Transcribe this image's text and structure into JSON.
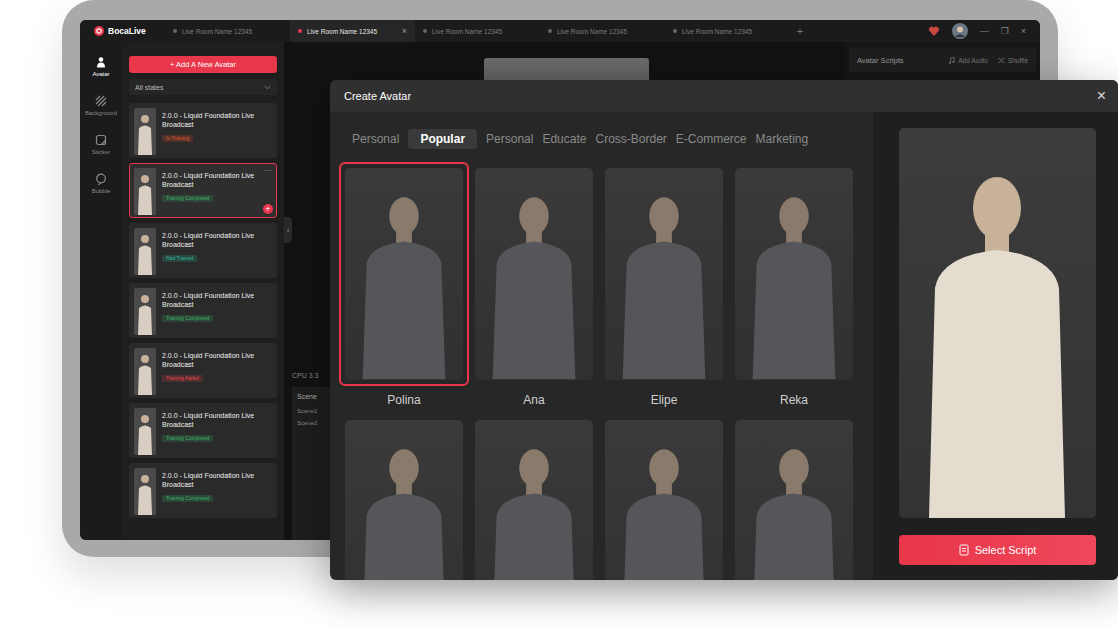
{
  "app": {
    "name": "BocaLive"
  },
  "tabs": [
    {
      "label": "Live Room Name 12345",
      "selected": false
    },
    {
      "label": "Live Room Name 12345",
      "selected": true
    },
    {
      "label": "Live Room Name 12345",
      "selected": false
    },
    {
      "label": "Live Room Name 12345",
      "selected": false
    },
    {
      "label": "Live Room Name 12345",
      "selected": false
    }
  ],
  "tab_close": "×",
  "new_tab": "+",
  "window_controls": [
    "—",
    "❐",
    "×"
  ],
  "rail": [
    {
      "label": "Avatar",
      "selected": true
    },
    {
      "label": "Background",
      "selected": false
    },
    {
      "label": "Sticker",
      "selected": false
    },
    {
      "label": "Bubble",
      "selected": false
    }
  ],
  "avatar_panel": {
    "add_button": "+ Add A New Avatar",
    "filter": "All states",
    "more": "···",
    "add": "+",
    "collapse": "‹",
    "items": [
      {
        "title": "2.0.0 - Liquid Foundation Live Broadcast",
        "status": "In Training",
        "color": "#e0552b",
        "selected": false
      },
      {
        "title": "2.0.0 - Liquid Foundation Live Broadcast",
        "status": "Training Completed",
        "color": "#3bb36a",
        "selected": true
      },
      {
        "title": "2.0.0 - Liquid Foundation Live Broadcast",
        "status": "Had Trained",
        "color": "#2fb59a",
        "selected": false
      },
      {
        "title": "2.0.0 - Liquid Foundation Live Broadcast",
        "status": "Training Completed",
        "color": "#3bb36a",
        "selected": false
      },
      {
        "title": "2.0.0 - Liquid Foundation Live Broadcast",
        "status": "Training Failed",
        "color": "#e5484d",
        "selected": false
      },
      {
        "title": "2.0.0 - Liquid Foundation Live Broadcast",
        "status": "Training Completed",
        "color": "#3bb36a",
        "selected": false
      },
      {
        "title": "2.0.0 - Liquid Foundation Live Broadcast",
        "status": "Training Completed",
        "color": "#3bb36a",
        "selected": false
      }
    ]
  },
  "stats": {
    "cpu": "CPU 3.3"
  },
  "scenes": {
    "title": "Scene",
    "items": [
      "Scene1",
      "Scene2"
    ]
  },
  "scripts_panel": {
    "title": "Avatar Scripts",
    "actions": [
      "Add Audio",
      "Shuffle"
    ]
  },
  "modal": {
    "title": "Create Avatar",
    "close": "×",
    "categories": [
      {
        "label": "Personal",
        "selected": false
      },
      {
        "label": "Popular",
        "selected": true
      },
      {
        "label": "Personal",
        "selected": false
      },
      {
        "label": "Educate",
        "selected": false
      },
      {
        "label": "Cross-Border",
        "selected": false
      },
      {
        "label": "E-Commerce",
        "selected": false
      },
      {
        "label": "Marketing",
        "selected": false
      }
    ],
    "avatars": [
      {
        "name": "Polina",
        "selected": true
      },
      {
        "name": "Ana",
        "selected": false
      },
      {
        "name": "Elipe",
        "selected": false
      },
      {
        "name": "Reka",
        "selected": false
      },
      {
        "name": "",
        "selected": false
      },
      {
        "name": "",
        "selected": false
      },
      {
        "name": "",
        "selected": false
      },
      {
        "name": "",
        "selected": false
      }
    ],
    "button": "Select Script"
  }
}
